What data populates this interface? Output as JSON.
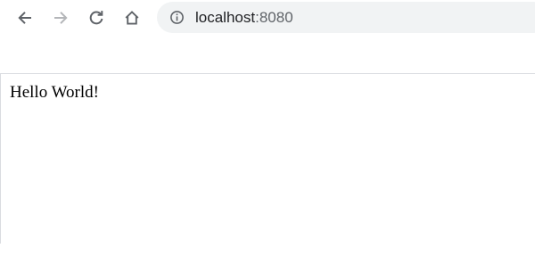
{
  "browser": {
    "toolbar": {
      "back_icon": "arrow-left-icon",
      "forward_icon": "arrow-right-icon",
      "reload_icon": "reload-icon",
      "home_icon": "home-icon",
      "icon_color": "#5f6368",
      "disabled_icon_color": "#b4b6b9"
    },
    "omnibox": {
      "site_info_icon": "info-circle-icon",
      "host": "localhost",
      "port": ":8080",
      "background": "#f1f3f4"
    }
  },
  "page": {
    "body_text": "Hello World!"
  }
}
